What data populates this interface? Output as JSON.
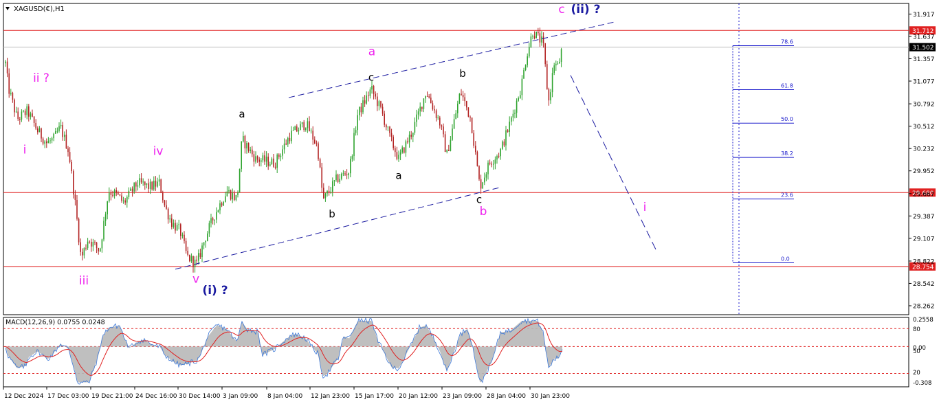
{
  "symbol_label": "XAGUSD(€),H1",
  "macd_label": "MACD(12,26,9) 0.0755 0.0248",
  "colors": {
    "background": "#ffffff",
    "axis": "#000000",
    "bull_candle": "#2ea32e",
    "bear_candle": "#b22222",
    "level_line": "#e02020",
    "channel": "#1a1aa0",
    "fib": "#1a1acc",
    "wave_pink": "#ee22ee",
    "wave_navy": "#1a1aa0",
    "wave_black": "#000000",
    "macd_hist": "#b8b8b8",
    "macd_main": "#3c78d8",
    "macd_signal": "#e02020"
  },
  "chart_data": [
    {
      "type": "candlestick",
      "title": "XAGUSD(€),H1",
      "yrange": [
        28.15,
        32.05
      ],
      "y_ticks": [
        "31.917",
        "31.637",
        "31.357",
        "31.077",
        "30.792",
        "30.512",
        "30.232",
        "29.952",
        "29.667",
        "29.387",
        "29.107",
        "28.822",
        "28.542",
        "28.262"
      ],
      "x_ticks": [
        "12 Dec 2024",
        "17 Dec 03:00",
        "19 Dec 21:00",
        "24 Dec 16:00",
        "30 Dec 14:00",
        "3 Jan 09:00",
        "8 Jan 04:00",
        "12 Jan 23:00",
        "15 Jan 17:00",
        "20 Jan 12:00",
        "23 Jan 09:00",
        "28 Jan 04:00",
        "30 Jan 23:00"
      ],
      "price_path_anchors": [
        [
          0,
          31.95
        ],
        [
          8,
          31.3
        ],
        [
          12,
          31.0
        ],
        [
          25,
          30.6
        ],
        [
          40,
          30.7
        ],
        [
          55,
          30.45
        ],
        [
          68,
          30.3
        ],
        [
          78,
          30.35
        ],
        [
          88,
          30.5
        ],
        [
          100,
          30.2
        ],
        [
          110,
          29.5
        ],
        [
          118,
          28.85
        ],
        [
          128,
          29.1
        ],
        [
          145,
          28.95
        ],
        [
          158,
          29.7
        ],
        [
          170,
          29.65
        ],
        [
          180,
          29.55
        ],
        [
          200,
          29.8
        ],
        [
          218,
          29.75
        ],
        [
          232,
          29.8
        ],
        [
          240,
          29.5
        ],
        [
          250,
          29.3
        ],
        [
          262,
          29.2
        ],
        [
          272,
          28.88
        ],
        [
          286,
          28.78
        ],
        [
          298,
          29.1
        ],
        [
          312,
          29.4
        ],
        [
          330,
          29.7
        ],
        [
          345,
          29.6
        ],
        [
          352,
          30.35
        ],
        [
          372,
          30.1
        ],
        [
          400,
          30.05
        ],
        [
          422,
          30.4
        ],
        [
          445,
          30.55
        ],
        [
          462,
          30.25
        ],
        [
          470,
          29.58
        ],
        [
          490,
          29.85
        ],
        [
          508,
          29.95
        ],
        [
          520,
          30.65
        ],
        [
          540,
          30.98
        ],
        [
          555,
          30.7
        ],
        [
          568,
          30.35
        ],
        [
          580,
          30.1
        ],
        [
          600,
          30.45
        ],
        [
          620,
          30.95
        ],
        [
          640,
          30.55
        ],
        [
          650,
          30.15
        ],
        [
          670,
          30.95
        ],
        [
          685,
          30.6
        ],
        [
          698,
          29.75
        ],
        [
          712,
          30.05
        ],
        [
          728,
          30.2
        ],
        [
          742,
          30.55
        ],
        [
          758,
          31.0
        ],
        [
          766,
          31.4
        ],
        [
          775,
          31.7
        ],
        [
          790,
          31.55
        ],
        [
          798,
          30.8
        ],
        [
          806,
          31.3
        ],
        [
          812,
          31.25
        ],
        [
          818,
          31.5
        ]
      ],
      "horizontal_levels": [
        {
          "value": 31.712,
          "label": "31.712"
        },
        {
          "value": 29.68,
          "label": "29.680"
        },
        {
          "value": 28.754,
          "label": "28.754"
        }
      ],
      "current_price": {
        "value": 31.502,
        "label": "31.502"
      },
      "fibonacci": [
        {
          "label": "78.6",
          "value": 31.52
        },
        {
          "label": "61.8",
          "value": 30.97
        },
        {
          "label": "50.0",
          "value": 30.55
        },
        {
          "label": "38.2",
          "value": 30.12
        },
        {
          "label": "23.6",
          "value": 29.6
        },
        {
          "label": "0.0",
          "value": 28.8
        }
      ],
      "channel_lines": [
        {
          "name": "upper",
          "from": [
            420,
            30.87
          ],
          "to": [
            895,
            31.82
          ]
        },
        {
          "name": "lower",
          "from": [
            255,
            28.72
          ],
          "to": [
            730,
            29.75
          ]
        }
      ],
      "projection_line": {
        "from": [
          830,
          31.15
        ],
        "to": [
          955,
          28.95
        ]
      },
      "wave_labels": [
        {
          "text": "ii ?",
          "x": 60,
          "y": 31.07,
          "color": "pink"
        },
        {
          "text": "i",
          "x": 36,
          "y": 30.17,
          "color": "pink"
        },
        {
          "text": "iv",
          "x": 230,
          "y": 30.15,
          "color": "pink"
        },
        {
          "text": "iii",
          "x": 122,
          "y": 28.53,
          "color": "pink"
        },
        {
          "text": "v",
          "x": 285,
          "y": 28.55,
          "color": "pink"
        },
        {
          "text": "(i) ?",
          "x": 313,
          "y": 28.41,
          "color": "navy"
        },
        {
          "text": "a",
          "x": 352,
          "y": 30.62,
          "color": "black"
        },
        {
          "text": "b",
          "x": 483,
          "y": 29.37,
          "color": "black"
        },
        {
          "text": "c",
          "x": 540,
          "y": 31.08,
          "color": "black"
        },
        {
          "text": "a",
          "x": 541,
          "y": 31.4,
          "color": "pink"
        },
        {
          "text": "a",
          "x": 580,
          "y": 29.85,
          "color": "black"
        },
        {
          "text": "b",
          "x": 673,
          "y": 31.13,
          "color": "black"
        },
        {
          "text": "c",
          "x": 697,
          "y": 29.55,
          "color": "black"
        },
        {
          "text": "b",
          "x": 703,
          "y": 29.4,
          "color": "pink"
        },
        {
          "text": "c",
          "x": 817,
          "y": 31.93,
          "color": "pink"
        },
        {
          "text": "(ii) ?",
          "x": 852,
          "y": 31.93,
          "color": "navy"
        },
        {
          "text": "i",
          "x": 938,
          "y": 29.45,
          "color": "pink"
        }
      ]
    },
    {
      "type": "line",
      "title": "MACD(12,26,9) 0.0755 0.0248",
      "yrange": [
        -0.36,
        0.26
      ],
      "y_ticks": [
        "0.2558",
        "80",
        "0.00",
        "50",
        "20",
        "-0.308"
      ],
      "dashed_levels": [
        0.16,
        0.0,
        -0.24
      ],
      "series": [
        {
          "name": "MACD",
          "value": 0.0755
        },
        {
          "name": "Signal",
          "value": 0.0248
        }
      ]
    }
  ]
}
